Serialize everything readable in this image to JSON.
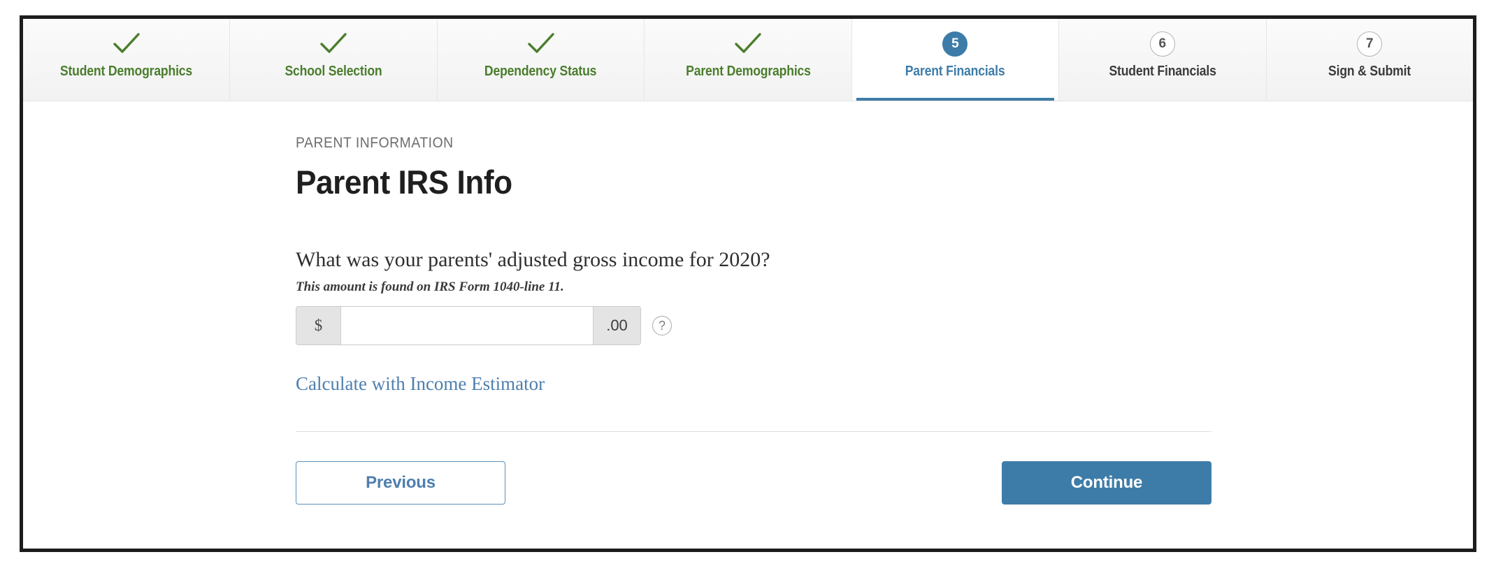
{
  "stepper": {
    "steps": [
      {
        "label": "Student Demographics",
        "state": "done",
        "mark": "check-icon"
      },
      {
        "label": "School Selection",
        "state": "done",
        "mark": "check-icon"
      },
      {
        "label": "Dependency Status",
        "state": "done",
        "mark": "check-icon"
      },
      {
        "label": "Parent Demographics",
        "state": "done",
        "mark": "check-icon"
      },
      {
        "label": "Parent Financials",
        "state": "current",
        "mark": "5"
      },
      {
        "label": "Student Financials",
        "state": "todo",
        "mark": "6"
      },
      {
        "label": "Sign & Submit",
        "state": "todo",
        "mark": "7"
      }
    ]
  },
  "main": {
    "eyebrow": "PARENT INFORMATION",
    "title": "Parent IRS Info",
    "question": "What was your parents' adjusted gross income for 2020?",
    "helper": "This amount is found on IRS Form 1040-line 11.",
    "field": {
      "prefix": "$",
      "suffix": ".00",
      "value": "",
      "placeholder": "",
      "help_icon": "question-mark-icon"
    },
    "estimator_link": "Calculate with Income Estimator"
  },
  "footer": {
    "previous_label": "Previous",
    "continue_label": "Continue"
  },
  "colors": {
    "accent_blue": "#3d7ca8",
    "link_blue": "#4e7fae",
    "done_green": "#4a7d2c",
    "addon_gray": "#e4e4e4",
    "frame_black": "#1d1d1d"
  }
}
